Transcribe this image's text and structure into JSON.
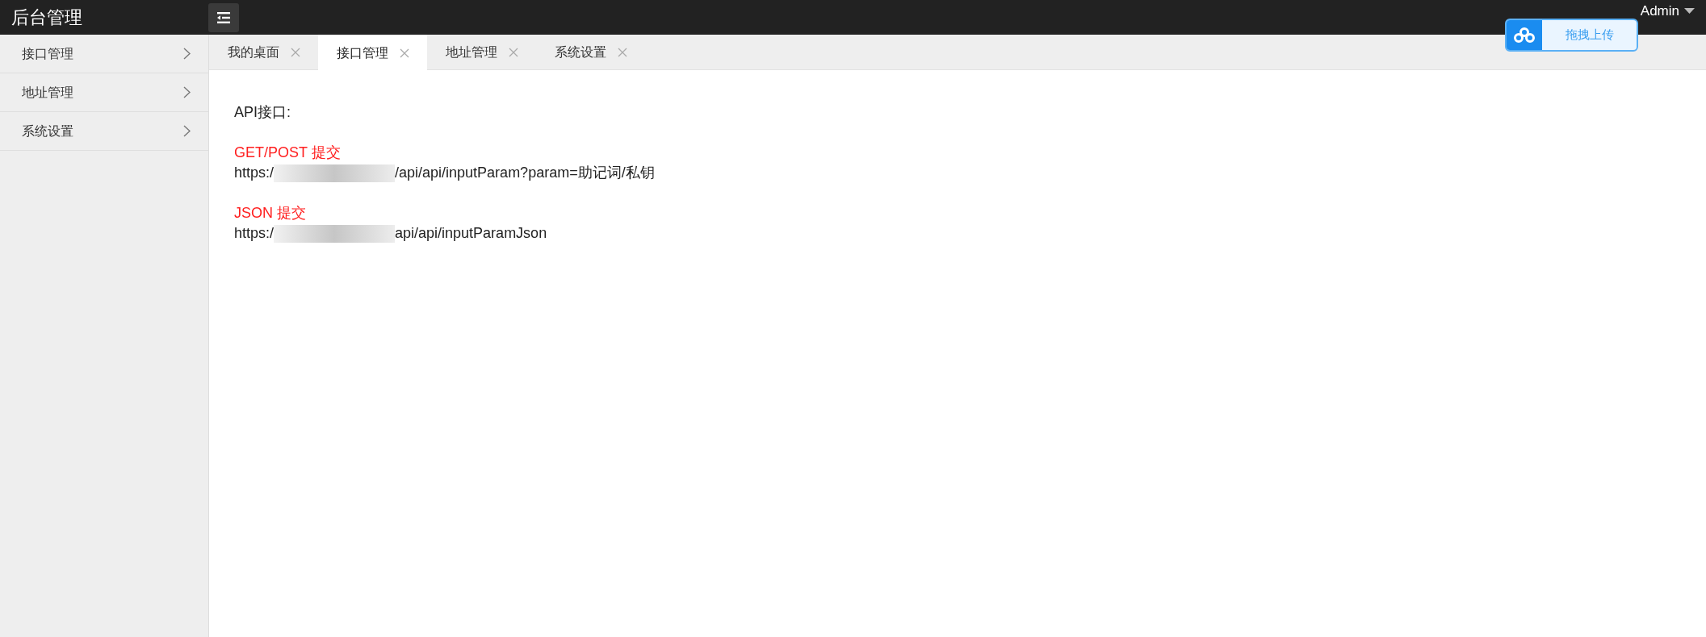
{
  "header": {
    "title": "后台管理",
    "user": "Admin"
  },
  "upload_button": {
    "label": "拖拽上传"
  },
  "sidebar": {
    "items": [
      {
        "label": "接口管理"
      },
      {
        "label": "地址管理"
      },
      {
        "label": "系统设置"
      }
    ]
  },
  "tabs": [
    {
      "label": "我的桌面",
      "selected": false
    },
    {
      "label": "接口管理",
      "selected": true
    },
    {
      "label": "地址管理",
      "selected": false
    },
    {
      "label": "系统设置",
      "selected": false
    }
  ],
  "content": {
    "heading": "API接口:",
    "sections": [
      {
        "title": "GET/POST 提交",
        "url_prefix": "https:/",
        "url_suffix": "/api/api/inputParam?param=助记词/私钥"
      },
      {
        "title": "JSON 提交",
        "url_prefix": "https:/",
        "url_suffix": "api/api/inputParamJson"
      }
    ]
  }
}
